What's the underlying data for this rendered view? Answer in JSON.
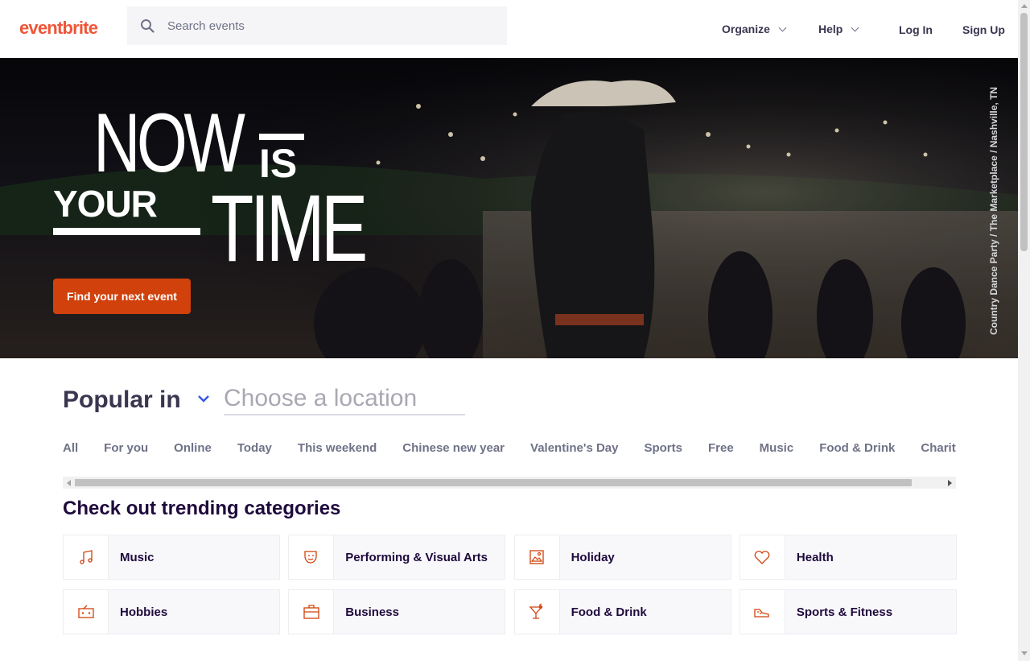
{
  "header": {
    "logo": "eventbrite",
    "search_placeholder": "Search events",
    "nav": {
      "organize": "Organize",
      "help": "Help",
      "login": "Log In",
      "signup": "Sign Up"
    }
  },
  "hero": {
    "headline": {
      "now": "NOW",
      "is": "IS",
      "your": "YOUR",
      "time": "TIME"
    },
    "cta": "Find your next event",
    "photo_credit": "Country Dance Party / The Marketplace / Nashville, TN"
  },
  "popular": {
    "label": "Popular in",
    "location_placeholder": "Choose a location",
    "tabs": [
      "All",
      "For you",
      "Online",
      "Today",
      "This weekend",
      "Chinese new year",
      "Valentine's Day",
      "Sports",
      "Free",
      "Music",
      "Food & Drink",
      "Charity & Causes"
    ]
  },
  "trending": {
    "title": "Check out trending categories",
    "categories": [
      {
        "label": "Music",
        "icon": "music-note-icon"
      },
      {
        "label": "Performing & Visual Arts",
        "icon": "theater-mask-icon"
      },
      {
        "label": "Holiday",
        "icon": "picture-frame-icon"
      },
      {
        "label": "Health",
        "icon": "heart-icon"
      },
      {
        "label": "Hobbies",
        "icon": "radio-icon"
      },
      {
        "label": "Business",
        "icon": "briefcase-icon"
      },
      {
        "label": "Food & Drink",
        "icon": "cocktail-icon"
      },
      {
        "label": "Sports & Fitness",
        "icon": "sneaker-icon"
      }
    ]
  },
  "colors": {
    "brand": "#f05537",
    "cta": "#d1410c",
    "text_dark": "#1e0a3c",
    "link_blue": "#3659e3"
  }
}
